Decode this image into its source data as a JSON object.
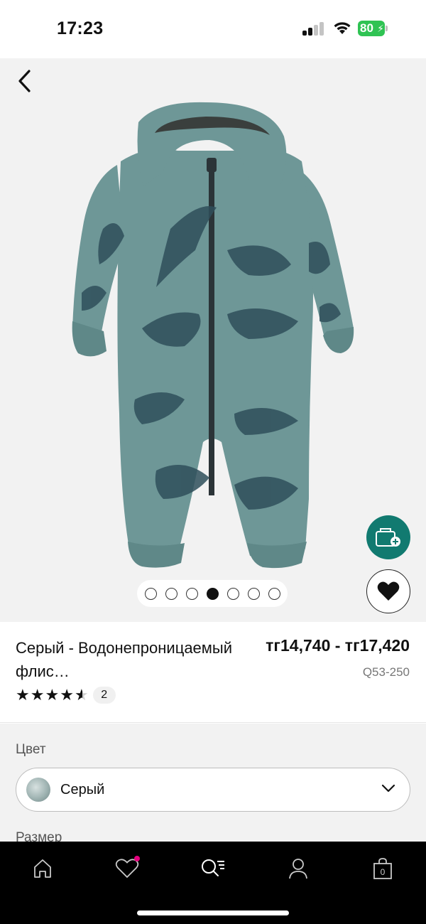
{
  "status_bar": {
    "time": "17:23",
    "battery": "80"
  },
  "product": {
    "title": "Серый - Водонепроницаемый флис…",
    "price": "тг14,740 - тг17,420",
    "sku": "Q53-250",
    "rating": 4.5,
    "review_count": "2"
  },
  "gallery": {
    "image_count": 7,
    "active_index": 3
  },
  "options": {
    "color_label": "Цвет",
    "color_value": "Серый",
    "size_label": "Размер"
  },
  "bottom_nav": {
    "items": [
      "home-icon",
      "wishlist-icon",
      "search-menu-icon",
      "account-icon",
      "bag-icon"
    ],
    "bag_count": "0"
  },
  "colors": {
    "accent": "#117a70",
    "wishlist_dot": "#e6007e",
    "battery": "#2fc353",
    "garment": "#6e9797",
    "print": "#2f4f5b"
  }
}
